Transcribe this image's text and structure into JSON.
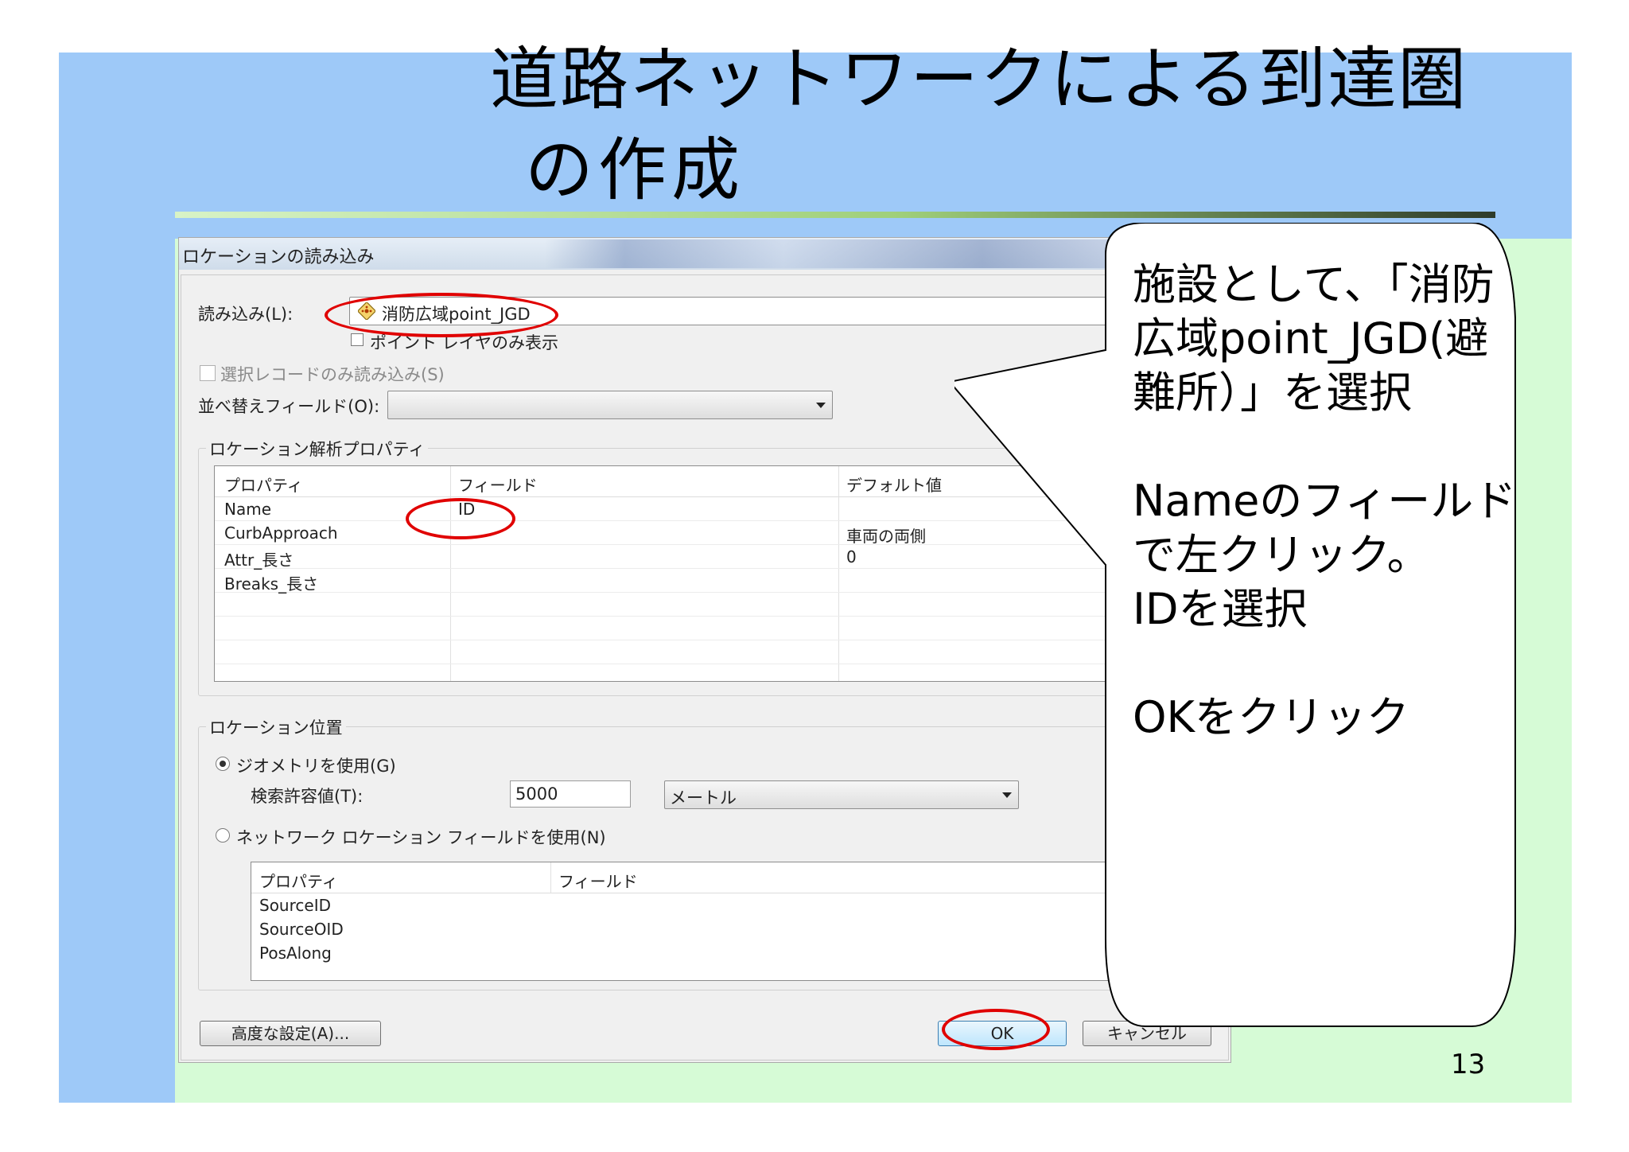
{
  "slide": {
    "title_line1": "道路ネットワークによる到達圏",
    "title_line2": "の作成",
    "page_number": "13",
    "colors": {
      "background": "#9ec9f8",
      "panel": "#d6fbd6",
      "highlight": "#e00000"
    }
  },
  "dialog": {
    "title": "ロケーションの読み込み",
    "load_label": "読み込み(L):",
    "load_value": "消防広域point_JGD",
    "layer_icon": "point-layer-icon",
    "point_layer_only_label": "ポイント レイヤのみ表示",
    "selected_only_label": "選択レコードのみ読み込み(S)",
    "sort_field_label": "並べ替えフィールド(O):",
    "sort_field_value": "",
    "analysis_props_group": "ロケーション解析プロパティ",
    "props_table": {
      "headers": [
        "プロパティ",
        "フィールド",
        "デフォルト値"
      ],
      "rows": [
        {
          "property": "Name",
          "field": "ID",
          "default": ""
        },
        {
          "property": "CurbApproach",
          "field": "",
          "default": "車両の両側"
        },
        {
          "property": "Attr_長さ",
          "field": "",
          "default": "0"
        },
        {
          "property": "Breaks_長さ",
          "field": "",
          "default": ""
        }
      ]
    },
    "location_group": "ロケーション位置",
    "use_geometry_label": "ジオメトリを使用(G)",
    "tolerance_label": "検索許容値(T):",
    "tolerance_value": "5000",
    "unit_value": "メートル",
    "use_network_fields_label": "ネットワーク ロケーション フィールドを使用(N)",
    "network_table": {
      "headers": [
        "プロパティ",
        "フィールド"
      ],
      "rows": [
        "SourceID",
        "SourceOID",
        "PosAlong"
      ]
    },
    "advanced_button": "高度な設定(A)...",
    "ok_button": "OK",
    "cancel_button": "キャンセル"
  },
  "callout": {
    "lines": [
      "施設として、「消防",
      "広域point_JGD(避",
      "難所）」を選択",
      "",
      "Nameのフィールド",
      "で左クリック。",
      "IDを選択",
      "",
      "OKをクリック"
    ]
  }
}
